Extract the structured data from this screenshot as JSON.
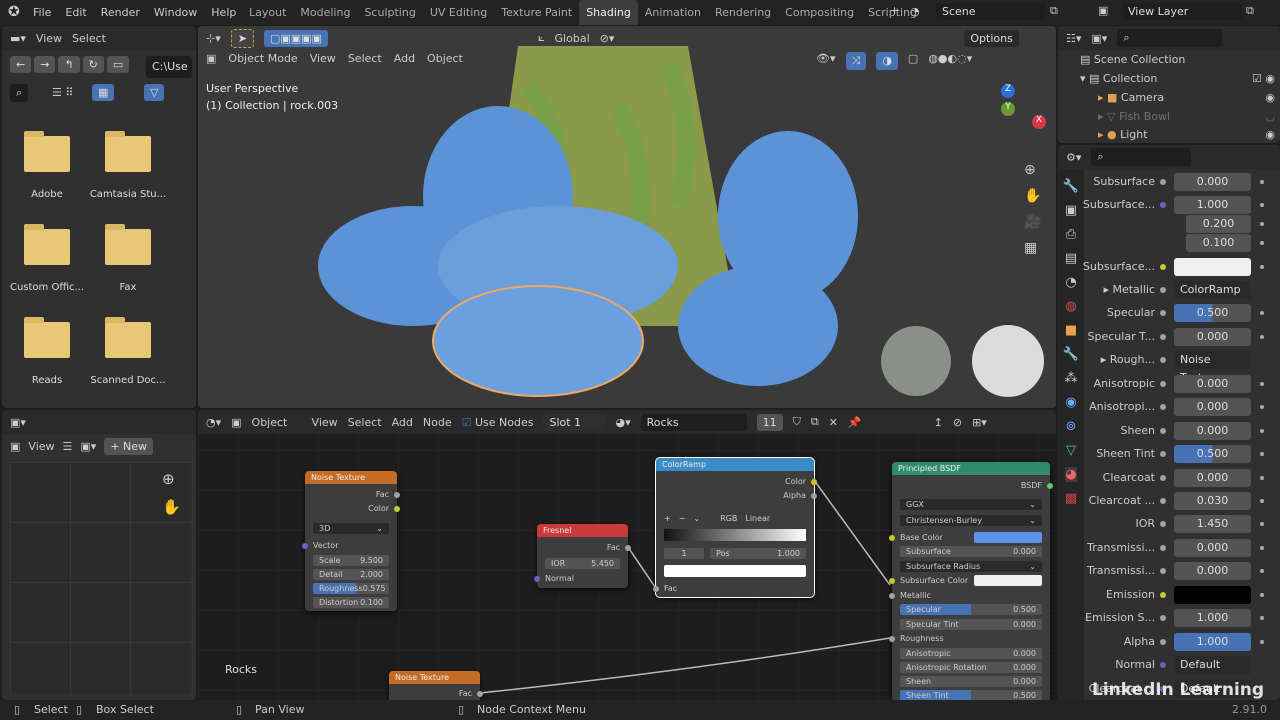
{
  "topbar": {
    "menus": [
      "File",
      "Edit",
      "Render",
      "Window",
      "Help"
    ],
    "workspaces": [
      "Layout",
      "Modeling",
      "Sculpting",
      "UV Editing",
      "Texture Paint",
      "Shading",
      "Animation",
      "Rendering",
      "Compositing",
      "Scripting"
    ],
    "active_workspace": "Shading",
    "scene": "Scene",
    "view_layer": "View Layer"
  },
  "file_browser": {
    "menu": [
      "View",
      "Select"
    ],
    "path": "C:\\Use",
    "folders": [
      "Adobe",
      "Camtasia Stu...",
      "Custom Offic...",
      "Fax",
      "Reads",
      "Scanned Doc..."
    ]
  },
  "viewport": {
    "mode": "Object Mode",
    "menu": [
      "View",
      "Select",
      "Add",
      "Object"
    ],
    "orientation": "Global",
    "options": "Options",
    "perspective": "User Perspective",
    "collection_info": "(1) Collection | rock.003",
    "gizmo": {
      "z": "Z",
      "y": "Y",
      "x": "X"
    }
  },
  "outliner": {
    "scene_collection": "Scene Collection",
    "collection": "Collection",
    "items": [
      "Camera",
      "Fish Bowl",
      "Light"
    ]
  },
  "properties": {
    "rows": [
      {
        "label": "Subsurface",
        "value": "0.000",
        "type": "num"
      },
      {
        "label": "Subsurface...",
        "value": "1.000",
        "type": "num",
        "socket": "#6363c7"
      },
      {
        "label": "",
        "value": "0.200",
        "type": "num"
      },
      {
        "label": "",
        "value": "0.100",
        "type": "num"
      },
      {
        "label": "Subsurface...",
        "value": "",
        "type": "color",
        "color": "#f0f0f0",
        "socket": "#c7c729"
      },
      {
        "label": "▸ Metallic",
        "value": "ColorRamp",
        "type": "link"
      },
      {
        "label": "Specular",
        "value": "0.500",
        "type": "slider",
        "fill": 0.5
      },
      {
        "label": "Specular T...",
        "value": "0.000",
        "type": "num"
      },
      {
        "label": "▸ Rough...",
        "value": "Noise Texture",
        "type": "link"
      },
      {
        "label": "Anisotropic",
        "value": "0.000",
        "type": "num"
      },
      {
        "label": "Anisotropi...",
        "value": "0.000",
        "type": "num"
      },
      {
        "label": "Sheen",
        "value": "0.000",
        "type": "num"
      },
      {
        "label": "Sheen Tint",
        "value": "0.500",
        "type": "slider",
        "fill": 0.5
      },
      {
        "label": "Clearcoat",
        "value": "0.000",
        "type": "num"
      },
      {
        "label": "Clearcoat ...",
        "value": "0.030",
        "type": "num"
      },
      {
        "label": "IOR",
        "value": "1.450",
        "type": "num"
      },
      {
        "label": "Transmissi...",
        "value": "0.000",
        "type": "num"
      },
      {
        "label": "Transmissi...",
        "value": "0.000",
        "type": "num"
      },
      {
        "label": "Emission",
        "value": "",
        "type": "color",
        "color": "#000000",
        "socket": "#c7c729"
      },
      {
        "label": "Emission S...",
        "value": "1.000",
        "type": "num"
      },
      {
        "label": "Alpha",
        "value": "1.000",
        "type": "slider",
        "fill": 1.0
      },
      {
        "label": "Normal",
        "value": "Default",
        "type": "link",
        "socket": "#6363c7"
      },
      {
        "label": "Clearcoat ...",
        "value": "Default",
        "type": "link",
        "socket": "#6363c7"
      }
    ]
  },
  "image_editor": {
    "view": "View",
    "new": "New"
  },
  "node_editor": {
    "object": "Object",
    "menu": [
      "View",
      "Select",
      "Add",
      "Node"
    ],
    "use_nodes": "Use Nodes",
    "slot": "Slot 1",
    "material": "Rocks",
    "users": "11",
    "material_label": "Rocks",
    "noise": {
      "title": "Noise Texture",
      "out_fac": "Fac",
      "out_color": "Color",
      "dim": "3D",
      "vector": "Vector",
      "scale_l": "Scale",
      "scale": "9.500",
      "detail_l": "Detail",
      "detail": "2.000",
      "rough_l": "Roughness",
      "rough": "0.575",
      "dist_l": "Distortion",
      "dist": "0.100"
    },
    "fresnel": {
      "title": "Fresnel",
      "fac": "Fac",
      "ior_l": "IOR",
      "ior": "5.450",
      "normal": "Normal"
    },
    "ramp": {
      "title": "ColorRamp",
      "color": "Color",
      "alpha": "Alpha",
      "mode": "RGB",
      "interp": "Linear",
      "index": "1",
      "pos_l": "Pos",
      "pos": "1.000",
      "fac": "Fac"
    },
    "bsdf": {
      "title": "Principled BSDF",
      "out": "BSDF",
      "dist": "GGX",
      "sss": "Christensen-Burley",
      "base": "Base Color",
      "sub_l": "Subsurface",
      "sub": "0.000",
      "subrad": "Subsurface Radius",
      "subcol": "Subsurface Color",
      "metal": "Metallic",
      "spec_l": "Specular",
      "spec": "0.500",
      "spect_l": "Specular Tint",
      "spect": "0.000",
      "rough": "Roughness",
      "aniso_l": "Anisotropic",
      "aniso": "0.000",
      "anrot_l": "Anisotropic Rotation",
      "anrot": "0.000",
      "sheen_l": "Sheen",
      "sheen": "0.000",
      "sheent_l": "Sheen Tint",
      "sheent": "0.500"
    },
    "noise2": {
      "title": "Noise Texture",
      "fac": "Fac"
    }
  },
  "status": {
    "select": "Select",
    "box": "Box Select",
    "pan": "Pan View",
    "context": "Node Context Menu",
    "version": "2.91.0"
  },
  "watermark": "LinkedIn Learning",
  "colors": {
    "accent": "#4772b3",
    "noise_header": "#c46b26",
    "fresnel_header": "#c93a3a",
    "ramp_header": "#3b8bc9",
    "bsdf_header": "#2e8c6a",
    "rock": "#5b93d6"
  }
}
